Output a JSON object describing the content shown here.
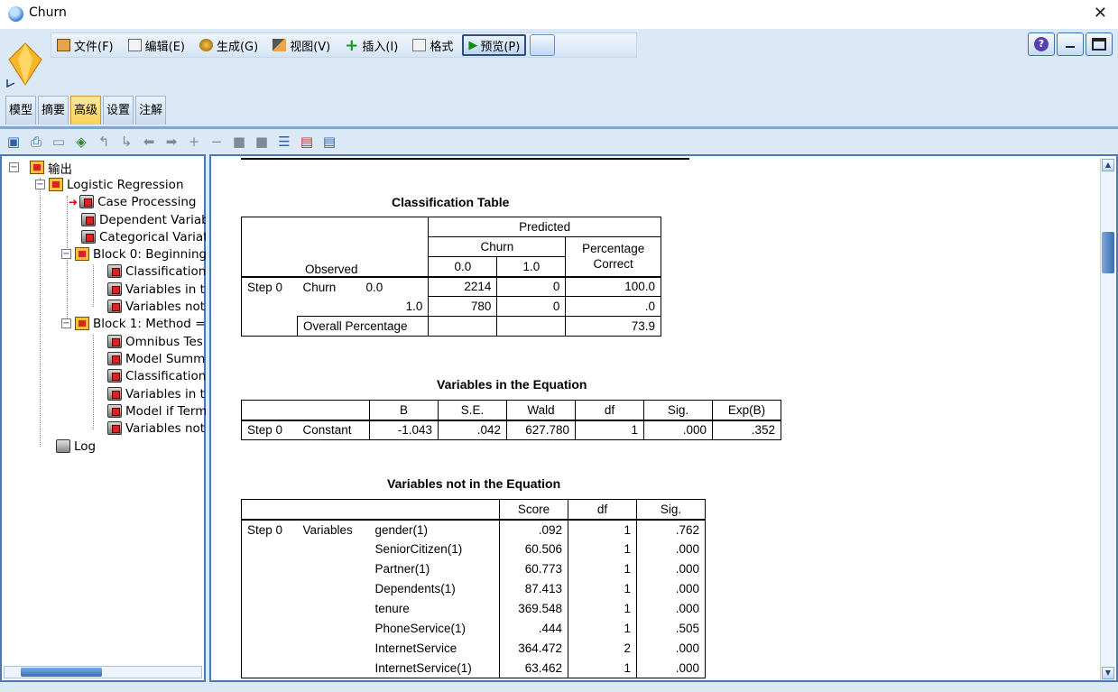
{
  "window": {
    "title": "Churn"
  },
  "menu": [
    {
      "label": "文件(F)",
      "icon": "file-icon"
    },
    {
      "label": "编辑(E)",
      "icon": "edit-icon"
    },
    {
      "label": "生成(G)",
      "icon": "generate-icon"
    },
    {
      "label": "视图(V)",
      "icon": "view-icon"
    },
    {
      "label": "插入(I)",
      "icon": "insert-plus-icon"
    },
    {
      "label": "格式",
      "icon": "format-icon"
    }
  ],
  "preview_label": "预览(P)",
  "tabs": [
    "模型",
    "摘要",
    "高级",
    "设置",
    "注解"
  ],
  "active_tab": "高级",
  "tree": {
    "root": "输出",
    "logistic": "Logistic Regression",
    "items": [
      "Case Processing",
      "Dependent Variab",
      "Categorical Variat",
      "Block 0: Beginning",
      "Classification",
      "Variables in th",
      "Variables not",
      "Block 1: Method =",
      "Omnibus Tes",
      "Model Summ",
      "Classification",
      "Variables in th",
      "Model if Term",
      "Variables not"
    ],
    "log": "Log"
  },
  "classification": {
    "title": "Classification Table",
    "predicted": "Predicted",
    "churn": "Churn",
    "pct_correct_1": "Percentage",
    "pct_correct_2": "Correct",
    "observed": "Observed",
    "col_00": "0.0",
    "col_10": "1.0",
    "step": "Step 0",
    "row_churn": "Churn",
    "r1_label": "0.0",
    "r1_a": "2214",
    "r1_b": "0",
    "r1_pct": "100.0",
    "r2_label": "1.0",
    "r2_a": "780",
    "r2_b": "0",
    "r2_pct": ".0",
    "overall": "Overall Percentage",
    "overall_pct": "73.9"
  },
  "equation": {
    "title": "Variables in the Equation",
    "headers": [
      "B",
      "S.E.",
      "Wald",
      "df",
      "Sig.",
      "Exp(B)"
    ],
    "step": "Step 0",
    "row_label": "Constant",
    "values": [
      "-1.043",
      ".042",
      "627.780",
      "1",
      ".000",
      ".352"
    ]
  },
  "not_in": {
    "title": "Variables not in the Equation",
    "headers": [
      "Score",
      "df",
      "Sig."
    ],
    "step": "Step 0",
    "group": "Variables",
    "rows": [
      {
        "name": "gender(1)",
        "score": ".092",
        "df": "1",
        "sig": ".762"
      },
      {
        "name": "SeniorCitizen(1)",
        "score": "60.506",
        "df": "1",
        "sig": ".000"
      },
      {
        "name": "Partner(1)",
        "score": "60.773",
        "df": "1",
        "sig": ".000"
      },
      {
        "name": "Dependents(1)",
        "score": "87.413",
        "df": "1",
        "sig": ".000"
      },
      {
        "name": "tenure",
        "score": "369.548",
        "df": "1",
        "sig": ".000"
      },
      {
        "name": "PhoneService(1)",
        "score": ".444",
        "df": "1",
        "sig": ".505"
      },
      {
        "name": "InternetService",
        "score": "364.472",
        "df": "2",
        "sig": ".000"
      },
      {
        "name": "InternetService(1)",
        "score": "63.462",
        "df": "1",
        "sig": ".000"
      }
    ]
  }
}
